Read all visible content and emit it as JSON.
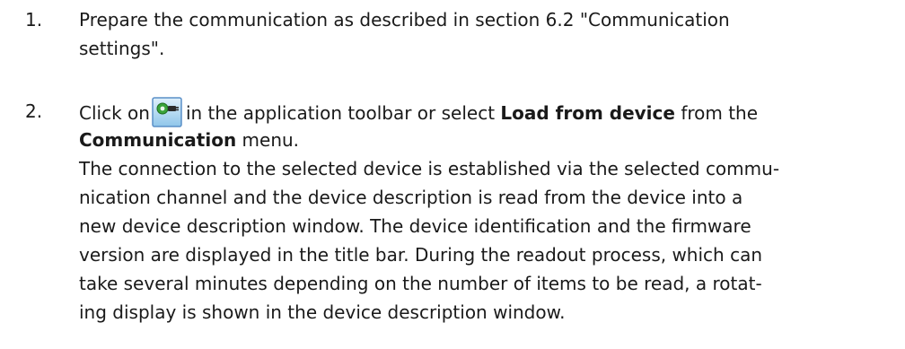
{
  "steps": [
    {
      "number": "1.",
      "lines": [
        "Prepare the communication as described in section 6.2 \"Communication",
        "settings\"."
      ]
    },
    {
      "number": "2.",
      "line1": {
        "before_icon": "Click on",
        "after_icon": "in the application toolbar or select",
        "bold_1": "Load from device",
        "after_bold_1": "from the"
      },
      "line2": {
        "bold_2": "Communication",
        "after_bold_2": "menu."
      },
      "lines": [
        "The connection to the selected device is established via the selected commu-",
        "nication channel and the device description is read from the device into a",
        "new device description window. The device identification and the firmware",
        "version are displayed in the title bar. During the readout process, which can",
        "take several minutes depending on the number of items to be read, a rotat-",
        "ing display is shown in the device description window."
      ]
    }
  ],
  "icons": {
    "load_from_device": "load-from-device-icon",
    "colors": {
      "frame": "#5a8fc7",
      "background_top": "#dff0fb",
      "background_bottom": "#8fc6ea",
      "plug_green": "#3aa33a",
      "plug_dark": "#2b2b2b"
    }
  }
}
